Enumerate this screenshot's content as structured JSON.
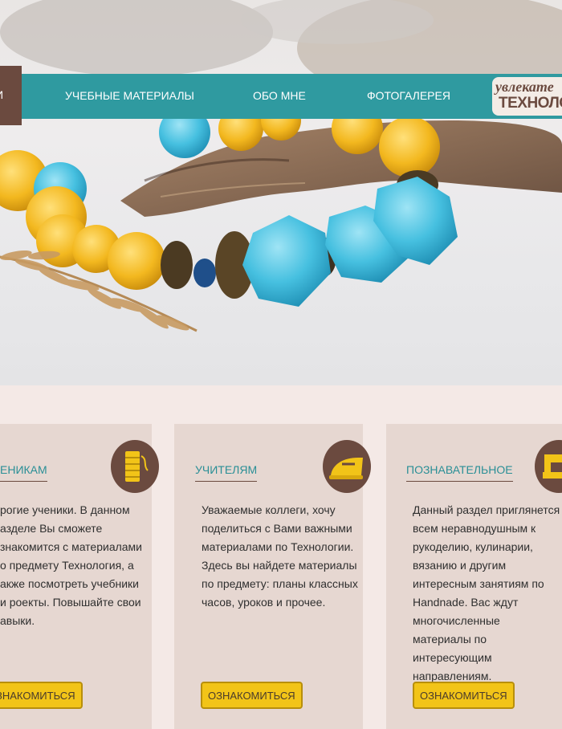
{
  "nav": {
    "active_label": "И",
    "items": [
      {
        "label": "УЧЕБНЫЕ МАТЕРИАЛЫ"
      },
      {
        "label": "ОБО МНЕ"
      },
      {
        "label": "ФОТОГАЛЕРЕЯ"
      }
    ],
    "logo_line1": "увлекате",
    "logo_line2": "ТЕХНОЛО"
  },
  "cards": [
    {
      "title": "ЕНИКАМ",
      "text": "рогие ученики. В данном азделе Вы сможете знакомится с материалами о предмету Технология, а акже посмотреть учебники и роекты. Повышайте свои авыки.",
      "button": "ЗНАКОМИТЬСЯ",
      "icon": "thread-spool-icon"
    },
    {
      "title": "УЧИТЕЛЯМ",
      "text": "Уважаемые коллеги, хочу поделиться с Вами важными материалами по Технологии. Здесь вы найдете материалы по предмету: планы классных часов, уроков и прочее.",
      "button": "ОЗНАКОМИТЬСЯ",
      "icon": "iron-icon"
    },
    {
      "title": "ПОЗНАВАТЕЛЬНОЕ",
      "text": "Данный раздел приглянется всем неравнодушным к рукоделию, кулинарии, вязанию и другим интересным занятиям по Handnade. Вас ждут многочисленные материалы по интересующим направлениям.",
      "button": "ОЗНАКОМИТЬСЯ",
      "icon": "sewing-machine-icon"
    }
  ],
  "colors": {
    "nav": "#2f9aa0",
    "brown": "#6b4a3f",
    "card_bg": "#e6d7d1",
    "page_bg": "#f4e9e6",
    "button": "#f2c418",
    "title": "#2a8f96"
  }
}
